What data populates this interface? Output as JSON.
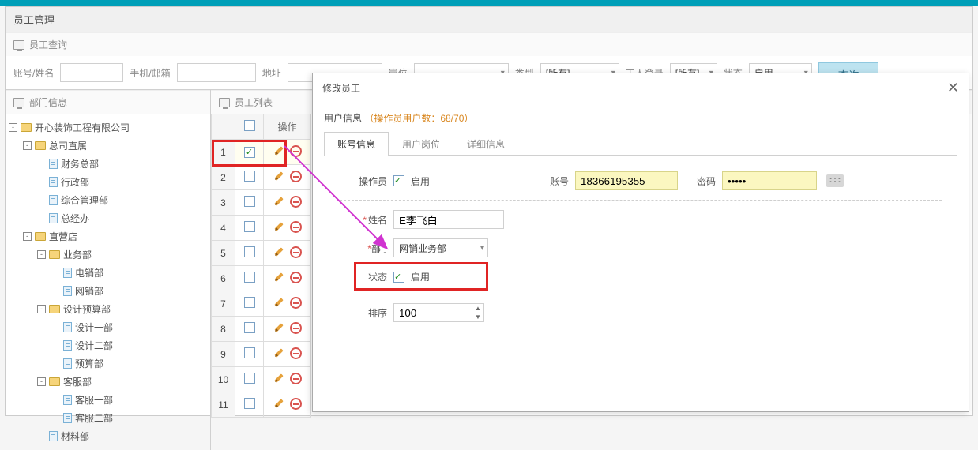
{
  "window_title": "员工管理",
  "search_panel_title": "员工查询",
  "search": {
    "account_label": "账号/姓名",
    "phone_label": "手机/邮箱",
    "address_label": "地址",
    "post_label": "岗位",
    "type_label": "类型",
    "type_value": "[所有]",
    "worker_login_label": "工人登录",
    "worker_login_value": "[所有]",
    "status_label": "状态",
    "status_value": "启用",
    "search_button": "查询"
  },
  "dept_panel_title": "部门信息",
  "list_panel_title": "员工列表",
  "tree": [
    {
      "label": "开心装饰工程有限公司",
      "icon": "folder",
      "toggle": "-",
      "indent": 0
    },
    {
      "label": "总司直属",
      "icon": "folder",
      "toggle": "-",
      "indent": 1
    },
    {
      "label": "财务总部",
      "icon": "page",
      "indent": 2
    },
    {
      "label": "行政部",
      "icon": "page",
      "indent": 2
    },
    {
      "label": "综合管理部",
      "icon": "page",
      "indent": 2
    },
    {
      "label": "总经办",
      "icon": "page",
      "indent": 2
    },
    {
      "label": "直营店",
      "icon": "folder",
      "toggle": "-",
      "indent": 1
    },
    {
      "label": "业务部",
      "icon": "folder",
      "toggle": "-",
      "indent": 2
    },
    {
      "label": "电销部",
      "icon": "page",
      "indent": 3
    },
    {
      "label": "网销部",
      "icon": "page",
      "indent": 3
    },
    {
      "label": "设计预算部",
      "icon": "folder",
      "toggle": "-",
      "indent": 2
    },
    {
      "label": "设计一部",
      "icon": "page",
      "indent": 3
    },
    {
      "label": "设计二部",
      "icon": "page",
      "indent": 3
    },
    {
      "label": "预算部",
      "icon": "page",
      "indent": 3
    },
    {
      "label": "客服部",
      "icon": "folder",
      "toggle": "-",
      "indent": 2
    },
    {
      "label": "客服一部",
      "icon": "page",
      "indent": 3
    },
    {
      "label": "客服二部",
      "icon": "page",
      "indent": 3
    },
    {
      "label": "材料部",
      "icon": "page",
      "indent": 2
    }
  ],
  "table": {
    "op_header": "操作",
    "rows": [
      1,
      2,
      3,
      4,
      5,
      6,
      7,
      8,
      9,
      10,
      11
    ]
  },
  "dialog": {
    "title": "修改员工",
    "user_info_label": "用户信息",
    "user_info_warn": "（操作员用户数：68/70）",
    "tabs": [
      "账号信息",
      "用户岗位",
      "详细信息"
    ],
    "operator_label": "操作员",
    "enable_label": "启用",
    "account_label": "账号",
    "account_value": "18366195355",
    "password_label": "密码",
    "password_value": "•••••",
    "name_label": "姓名",
    "name_value": "E李飞白",
    "dept_label": "门",
    "dept_value": "网销业务部",
    "status_label": "状态",
    "sort_label": "排序",
    "sort_value": "100"
  }
}
